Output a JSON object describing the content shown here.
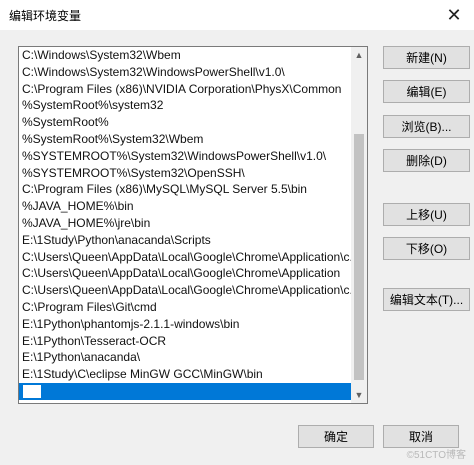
{
  "window": {
    "title": "编辑环境变量",
    "close_glyph": "✕"
  },
  "list": {
    "items": [
      "C:\\Windows\\System32\\Wbem",
      "C:\\Windows\\System32\\WindowsPowerShell\\v1.0\\",
      "C:\\Program Files (x86)\\NVIDIA Corporation\\PhysX\\Common",
      "%SystemRoot%\\system32",
      "%SystemRoot%",
      "%SystemRoot%\\System32\\Wbem",
      "%SYSTEMROOT%\\System32\\WindowsPowerShell\\v1.0\\",
      "%SYSTEMROOT%\\System32\\OpenSSH\\",
      "C:\\Program Files (x86)\\MySQL\\MySQL Server 5.5\\bin",
      "%JAVA_HOME%\\bin",
      "%JAVA_HOME%\\jre\\bin",
      "E:\\1Study\\Python\\anacanda\\Scripts",
      "C:\\Users\\Queen\\AppData\\Local\\Google\\Chrome\\Application\\c...",
      "C:\\Users\\Queen\\AppData\\Local\\Google\\Chrome\\Application",
      "C:\\Users\\Queen\\AppData\\Local\\Google\\Chrome\\Application\\c...",
      "C:\\Program Files\\Git\\cmd",
      "E:\\1Python\\phantomjs-2.1.1-windows\\bin",
      "E:\\1Python\\Tesseract-OCR",
      "E:\\1Python\\anacanda\\",
      "E:\\1Study\\C\\eclipse MinGW GCC\\MinGW\\bin"
    ],
    "new_entry_value": ""
  },
  "buttons": {
    "new": "新建(N)",
    "edit": "编辑(E)",
    "browse": "浏览(B)...",
    "delete": "删除(D)",
    "move_up": "上移(U)",
    "move_down": "下移(O)",
    "edit_text": "编辑文本(T)...",
    "ok": "确定",
    "cancel": "取消"
  },
  "watermark": "©51CTO博客",
  "colors": {
    "selection": "#0078d7",
    "window_bg": "#f0f0f0"
  }
}
